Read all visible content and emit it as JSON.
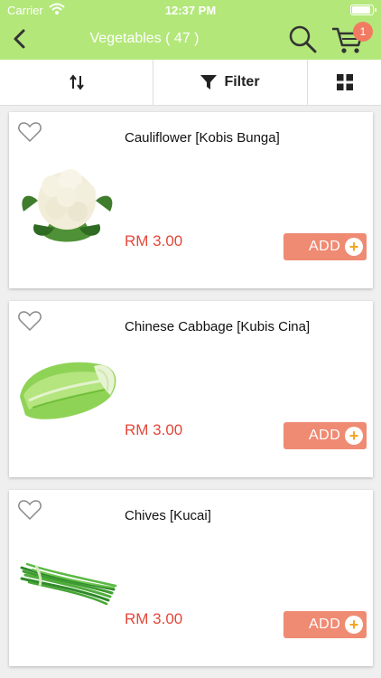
{
  "status_bar": {
    "carrier": "Carrier",
    "time": "12:37 PM"
  },
  "nav": {
    "title": "Vegetables ( 47 )",
    "cart_count": "1",
    "icons": [
      "back-arrow-icon",
      "search-icon",
      "cart-icon"
    ]
  },
  "toolbar": {
    "sort_icon": "sort-arrows-icon",
    "filter_label": "Filter",
    "filter_icon": "funnel-icon",
    "view_icon": "grid-view-icon"
  },
  "products": [
    {
      "name": "Cauliflower [Kobis Bunga]",
      "price": "RM 3.00",
      "add_label": "ADD",
      "image": "cauliflower-image"
    },
    {
      "name": "Chinese Cabbage [Kubis Cina]",
      "price": "RM 3.00",
      "add_label": "ADD",
      "image": "chinese-cabbage-image"
    },
    {
      "name": "Chives [Kucai]",
      "price": "RM 3.00",
      "add_label": "ADD",
      "image": "chives-image"
    }
  ],
  "colors": {
    "header_green": "#b3e77a",
    "price_red": "#e4473a",
    "add_button": "#ef8a73",
    "badge": "#f07b62"
  }
}
